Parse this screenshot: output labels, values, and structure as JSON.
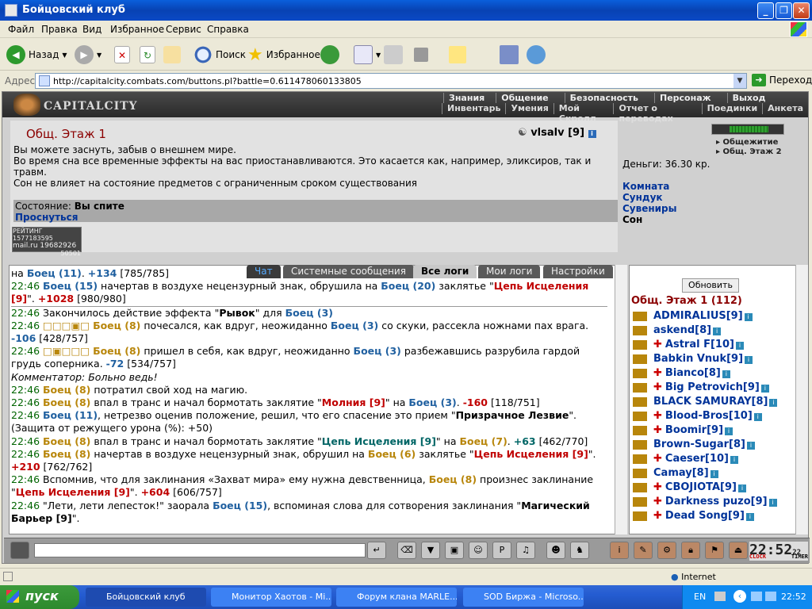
{
  "window": {
    "title": "Бойцовский клуб"
  },
  "menubar": [
    "Файл",
    "Правка",
    "Вид",
    "Избранное",
    "Сервис",
    "Справка"
  ],
  "toolbar": {
    "back": "Назад",
    "search": "Поиск",
    "favorites": "Избранное"
  },
  "address": {
    "label": "Адрес:",
    "url": "http://capitalcity.combats.com/buttons.pl?battle=0.611478060133805",
    "go": "Переход"
  },
  "game": {
    "logo": "CAPITALCITY",
    "nav_top": [
      "Знания",
      "Общение",
      "Безопасность",
      "Персонаж",
      "Выход"
    ],
    "nav_bottom": [
      "Инвентарь",
      "Умения",
      "Мой Скролл",
      "Отчет о переводах",
      "Поединки",
      "Анкета"
    ],
    "room_title": "Общ. Этаж 1",
    "user": "vlsalv [9]",
    "desc": [
      "Вы можете заснуть, забыв о внешнем мире.",
      "Во время сна все временные эффекты на вас приостанавливаются. Это касается как, например, эликсиров, так и травм.",
      "Сон не влияет на состояние предметов с ограниченным сроком существования"
    ],
    "state_label": "Состояние: ",
    "state_value": "Вы спите",
    "wake": "Проснуться",
    "counter": [
      "РЕЙТИНГ 1577183595",
      "mail.ru 19682926",
      "50501"
    ],
    "money": "Деньги: 36.30 кр.",
    "links": [
      "Комната",
      "Сундук",
      "Сувениры",
      "Сон"
    ],
    "hp_fill": 0.74,
    "sub_links": [
      "Общежитие",
      "Общ. Этаж 2"
    ]
  },
  "tabs": [
    "Чат",
    "Системные сообщения",
    "Все логи",
    "Мои логи",
    "Настройки"
  ],
  "userlist": {
    "refresh": "Обновить",
    "title": "Общ. Этаж 1 (112)",
    "users": [
      "ADMIRALIUS[9]",
      "askend[8]",
      "Astral F[10]",
      "Babkin Vnuk[9]",
      "Bianco[8]",
      "Big Petrovich[9]",
      "BLACK SAMURAY[8]",
      "Blood-Bros[10]",
      "Boomir[9]",
      "Brown-Sugar[8]",
      "Caeser[10]",
      "Camay[8]",
      "CBOJIOTA[9]",
      "Darkness puzo[9]",
      "Dead Song[9]"
    ]
  },
  "clock": {
    "time": "22:52",
    "sub": "22",
    "labels": [
      "CLOCK",
      "TIMER"
    ]
  },
  "statusbar": {
    "zone": "Internet"
  },
  "taskbar": {
    "start": "пуск",
    "tasks": [
      "Бойцовский клуб",
      "Монитор Хаотов - Mi...",
      "Форум клана MARLE...",
      "SOD Биржа - Microso..."
    ],
    "lang": "EN",
    "time": "22:52"
  }
}
